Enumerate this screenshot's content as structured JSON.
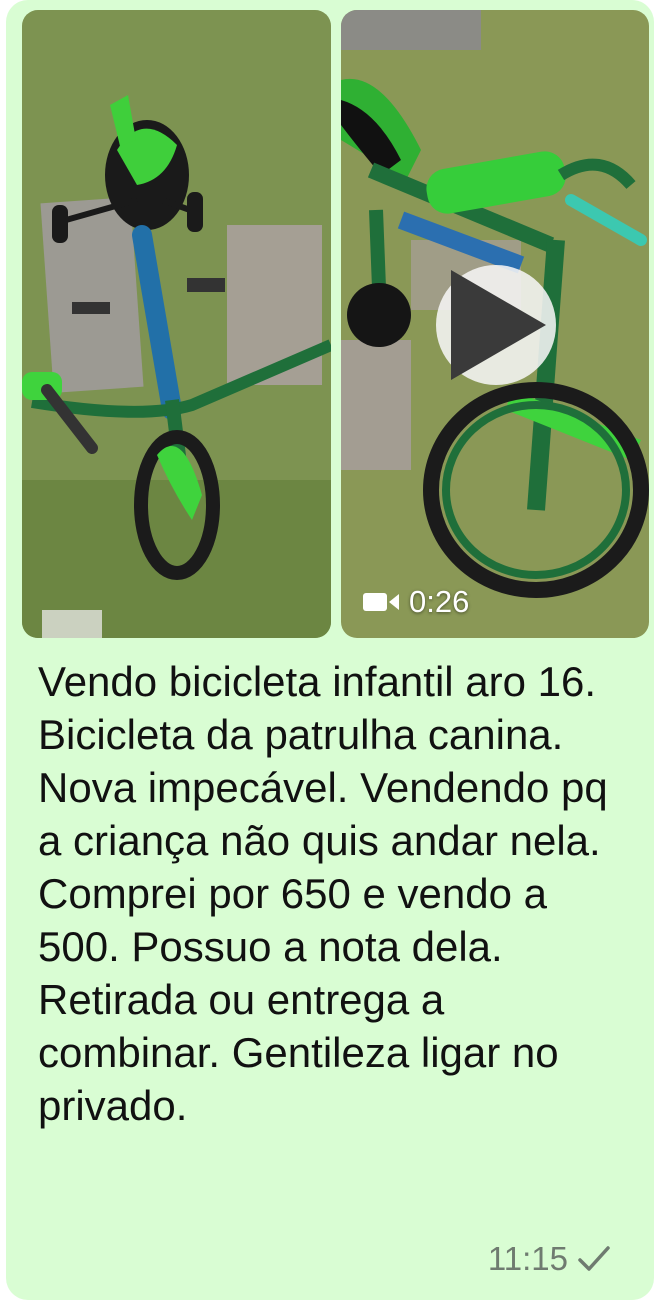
{
  "message": {
    "caption": "Vendo bicicleta infantil aro 16. Bicicleta da patrulha canina. Nova impecável. Vendendo pq a criança não quis andar nela. Comprei por 650 e vendo a 500. Possuo a nota dela. Retirada ou entrega a combinar. Gentileza ligar no privado.",
    "time": "11:15",
    "status_icon": "check-icon"
  },
  "media": [
    {
      "type": "photo",
      "subject": "green kids bicycle on grass"
    },
    {
      "type": "video",
      "duration": "0:26",
      "icons": [
        "play-icon",
        "video-camera-icon"
      ]
    }
  ],
  "colors": {
    "bubble": "#d9fdd3",
    "grass": "#6f8f4a",
    "bike_green": "#1f8a3a",
    "bright_green": "#3fd33d",
    "tire": "#1b1b1b"
  }
}
